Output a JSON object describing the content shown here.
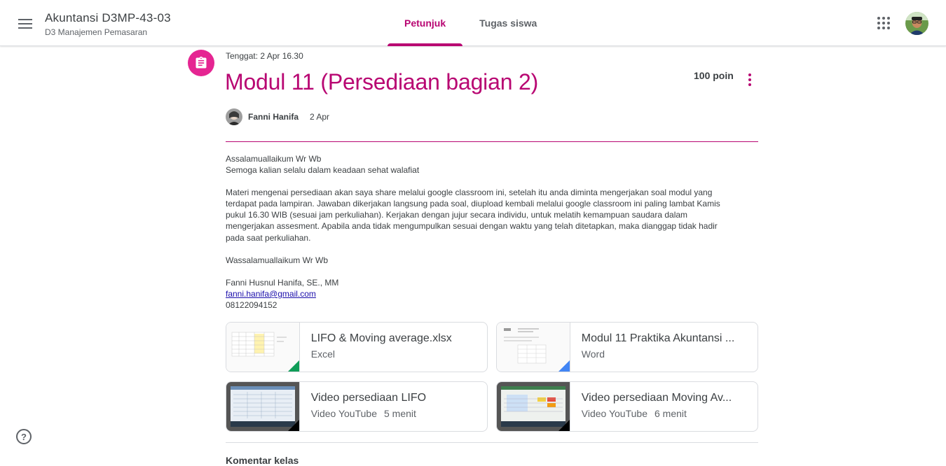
{
  "header": {
    "class_title": "Akuntansi D3MP-43-03",
    "class_subtitle": "D3 Manajemen Pemasaran",
    "tabs": [
      {
        "label": "Petunjuk",
        "active": true
      },
      {
        "label": "Tugas siswa",
        "active": false
      }
    ],
    "menu_icon": "hamburger-menu-icon",
    "apps_icon": "google-apps-grid-icon"
  },
  "assignment": {
    "icon": "assignment-clipboard-icon",
    "due": "Tenggat: 2 Apr 16.30",
    "title": "Modul 11 (Persediaan bagian 2)",
    "points": "100 poin",
    "author": "Fanni Hanifa",
    "date": "2 Apr",
    "accent_color": "#b80672",
    "icon_bg_color": "#e52592"
  },
  "body": {
    "lines": [
      "Assalamuallaikum Wr Wb",
      "Semoga kalian selalu dalam keadaan sehat walafiat",
      "",
      "Materi mengenai persediaan akan saya share melalui google classroom ini, setelah itu anda diminta mengerjakan soal modul yang",
      "terdapat pada lampiran. Jawaban dikerjakan langsung pada soal, diupload kembali melalui google classroom ini paling lambat Kamis",
      "pukul 16.30 WIB (sesuai jam perkuliahan). Kerjakan dengan jujur secara individu, untuk melatih kemampuan saudara dalam",
      "mengerjakan assesment. Apabila anda tidak mengumpulkan sesuai dengan waktu yang telah ditetapkan, maka dianggap tidak hadir",
      "pada saat perkuliahan.",
      "",
      "Wassalamuallaikum Wr Wb",
      "",
      "Fanni Husnul Hanifa, SE., MM"
    ],
    "email": "fanni.hanifa@gmail.com",
    "phone": "08122094152"
  },
  "attachments": [
    {
      "title": "LIFO & Moving average.xlsx",
      "type": "Excel",
      "duration": "",
      "corner_color": "#0f9d58"
    },
    {
      "title": "Modul 11 Praktika Akuntansi ...",
      "type": "Word",
      "duration": "",
      "corner_color": "#4285f4"
    },
    {
      "title": "Video persediaan LIFO",
      "type": "Video YouTube",
      "duration": "5 menit",
      "corner_color": "#000000"
    },
    {
      "title": "Video persediaan Moving Av...",
      "type": "Video YouTube",
      "duration": "6 menit",
      "corner_color": "#000000"
    }
  ],
  "comments": {
    "label": "Komentar kelas"
  },
  "help_icon": "help-circle-icon"
}
